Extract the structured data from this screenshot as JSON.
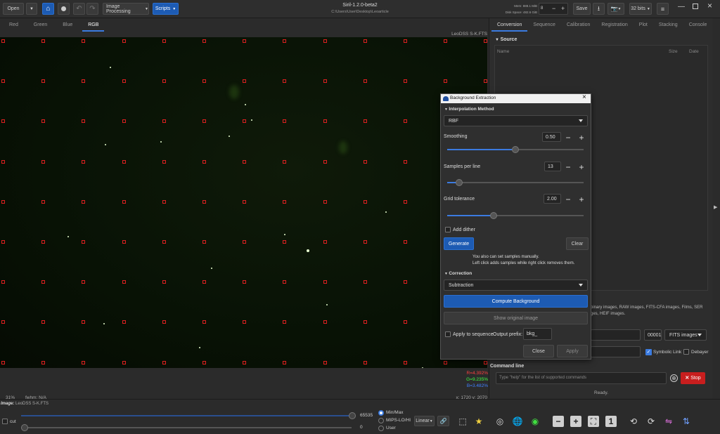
{
  "toolbar": {
    "open": "Open",
    "image_processing": "Image Processing",
    "scripts": "Scripts",
    "title": "Siril-1.2.0-beta2",
    "path": "C:\\Users\\User\\Desktop\\Leoarticle",
    "mem": "Mem: 888.1 MiB",
    "disk": "Disk Space: 482.6 GiB",
    "save": "Save",
    "bits": "32 bits"
  },
  "channel_tabs": [
    "Red",
    "Green",
    "Blue",
    "RGB"
  ],
  "viewer": {
    "filename": "LeoDSS S-K.FTS",
    "zoom": "31%",
    "fwhm": "fwhm: N/A",
    "coords": "x: 1720 y: 2070",
    "rgb_r": "R=4.392%",
    "rgb_g": "G=9.235%",
    "rgb_b": "B=3.482%"
  },
  "right_tabs": [
    "Conversion",
    "Sequence",
    "Calibration",
    "Registration",
    "Plot",
    "Stacking",
    "Console"
  ],
  "conversion": {
    "source_header": "Source",
    "col_name": "Name",
    "col_size": "Size",
    "col_date": "Date",
    "info_line1": "binary images, RAW images, FITS-CFA images, Films, SER",
    "info_line2": "ges, HEIF images.",
    "counter": "00001",
    "format": "FITS images",
    "symbolic_link": "Symbolic Link",
    "debayer": "Debayer"
  },
  "command": {
    "label": "Command line",
    "placeholder": "Type \"help\" for the list of supported commands",
    "stop": "Stop",
    "status": "Ready."
  },
  "dialog": {
    "title": "Background Extraction",
    "interp_header": "Interpolation Method",
    "method": "RBF",
    "smoothing_label": "Smoothing",
    "smoothing_value": "0.50",
    "smoothing_level": 0.5,
    "samples_label": "Samples per line",
    "samples_value": "13",
    "samples_level": 0.09,
    "tolerance_label": "Grid tolerance",
    "tolerance_value": "2.00",
    "tolerance_level": 0.34,
    "add_dither": "Add dither",
    "generate": "Generate",
    "clear": "Clear",
    "hint1": "You also can set samples manually.",
    "hint2": "Left click adds samples while right click removes them.",
    "correction_header": "Correction",
    "correction": "Subtraction",
    "compute": "Compute Background",
    "show_original": "Show original image",
    "apply_seq": "Apply to sequence",
    "prefix_label": "Output prefix:",
    "prefix": "bkg_",
    "close": "Close",
    "apply": "Apply"
  },
  "bottom": {
    "image_label": "Image:",
    "image_name": "LeoDSS S-K.FTS",
    "cut": "cut",
    "max": "65535",
    "min": "0",
    "minmax": "Min/Max",
    "mips": "MIPS-LO/HI",
    "user": "User",
    "linear": "Linear"
  },
  "colors": {
    "accent": "#1d5bb3",
    "marker": "#e02020",
    "stop": "#c81e1e"
  }
}
